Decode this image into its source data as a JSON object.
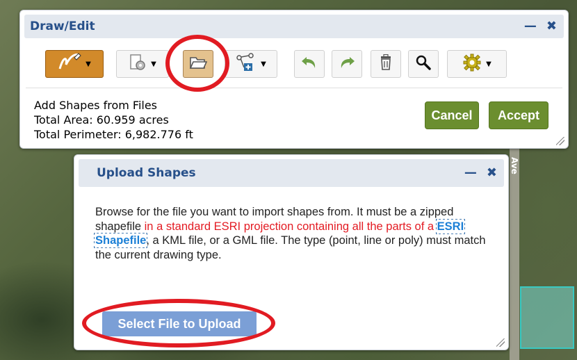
{
  "road_label": "Ave",
  "draw_panel": {
    "title": "Draw/Edit",
    "minimize_icon": "minus-icon",
    "close_icon": "x-icon",
    "toolbar": [
      {
        "name": "draw-tool",
        "icon": "pencil-icon",
        "dropdown": true,
        "active": true
      },
      {
        "name": "edit-tool",
        "icon": "gear-sheet-icon",
        "dropdown": true
      },
      {
        "name": "open-file",
        "icon": "folder-icon",
        "dropdown": false,
        "highlighted": true
      },
      {
        "name": "add-vertex",
        "icon": "node-add-icon",
        "dropdown": true
      },
      {
        "name": "undo",
        "icon": "undo-arrow-icon",
        "dropdown": false
      },
      {
        "name": "redo",
        "icon": "redo-arrow-icon",
        "dropdown": false
      },
      {
        "name": "delete",
        "icon": "trash-icon",
        "dropdown": false
      },
      {
        "name": "search",
        "icon": "magnifier-icon",
        "dropdown": false
      },
      {
        "name": "settings",
        "icon": "gear-icon",
        "dropdown": true
      }
    ],
    "status": {
      "line1": "Add Shapes from Files",
      "line2": "Total Area: 60.959 acres",
      "line3": "Total Perimeter: 6,982.776 ft"
    },
    "cancel_label": "Cancel",
    "accept_label": "Accept"
  },
  "upload_panel": {
    "title": "Upload Shapes",
    "text_part1": "Browse for the file you want to import shapes from. It must be a zipped shapefile ",
    "text_red": "in a standard ESRI projection containing all the parts of a",
    "text_space": " ",
    "text_link": "ESRI Shapefile",
    "text_part2": ", a KML file, or a GML file. The type (point, line or poly) must match the current drawing type.",
    "select_label": "Select File to Upload"
  },
  "colors": {
    "header_text": "#27508a",
    "accent_green": "#6b8e2f",
    "annotation_red": "#e11b22",
    "select_button": "#7b9fd6",
    "active_tool_orange": "#d28a2a"
  }
}
